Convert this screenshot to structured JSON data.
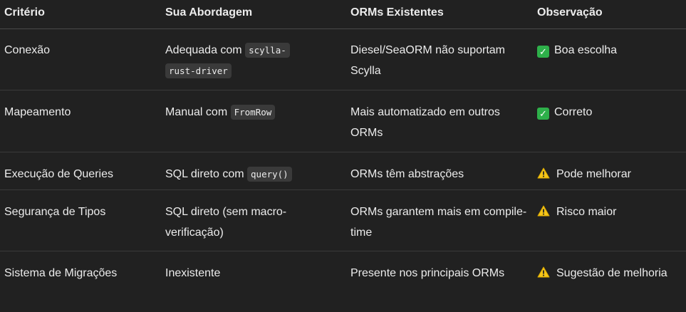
{
  "headers": [
    "Critério",
    "Sua Abordagem",
    "ORMs Existentes",
    "Observação"
  ],
  "rows": [
    {
      "criterio": "Conexão",
      "abordagem_text": "Adequada com ",
      "abordagem_code": "scylla-rust-driver",
      "abordagem_code_part1": "scylla-",
      "abordagem_code_part2": "rust-driver",
      "orms": "Diesel/SeaORM não suportam Scylla",
      "obs_icon": "check-icon",
      "obs": "Boa escolha"
    },
    {
      "criterio": "Mapeamento",
      "abordagem_text": "Manual com ",
      "abordagem_code": "FromRow",
      "orms": "Mais automatizado em outros ORMs",
      "obs_icon": "check-icon",
      "obs": "Correto"
    },
    {
      "criterio": "Execução de Queries",
      "abordagem_text": "SQL direto com ",
      "abordagem_code": "query()",
      "orms": "ORMs têm abstrações",
      "obs_icon": "warning-icon",
      "obs": "Pode melhorar"
    },
    {
      "criterio": "Segurança de Tipos",
      "abordagem_text": "SQL direto (sem macro-verificação)",
      "orms": "ORMs garantem mais em compile-time",
      "obs_icon": "warning-icon",
      "obs": "Risco maior"
    },
    {
      "criterio": "Sistema de Migrações",
      "abordagem_text": "Inexistente",
      "orms": "Presente nos principais ORMs",
      "obs_icon": "warning-icon",
      "obs": "Sugestão de melhoria"
    }
  ],
  "colors": {
    "background": "#212121",
    "text": "#ececec",
    "check": "#2eb04a",
    "warning": "#f5c518"
  }
}
